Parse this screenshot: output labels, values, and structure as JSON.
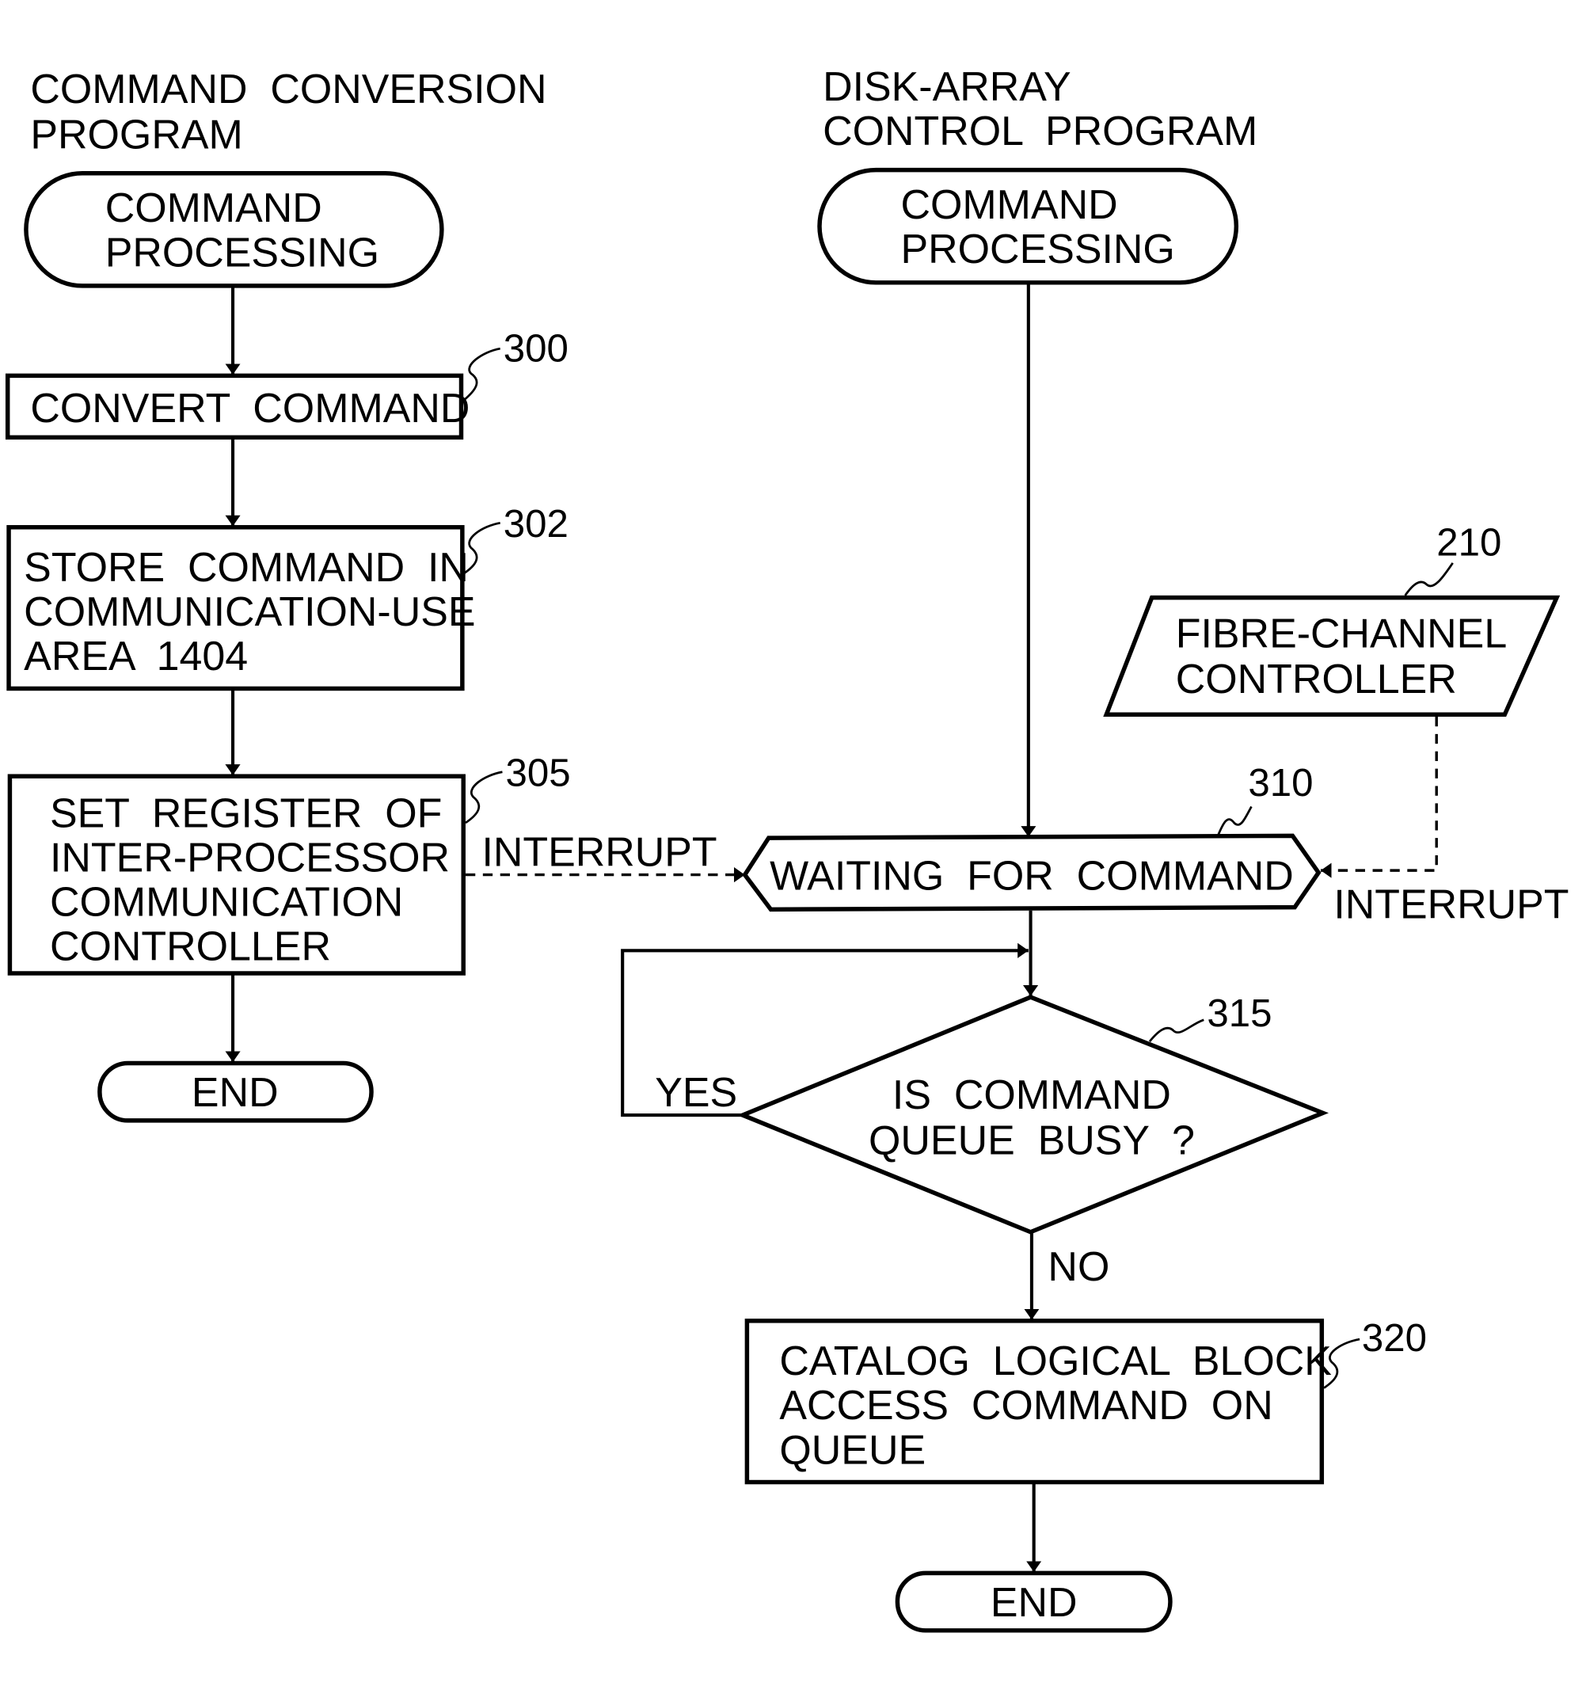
{
  "left_column": {
    "title": [
      "COMMAND  CONVERSION",
      "PROGRAM"
    ],
    "start": [
      "COMMAND",
      "PROCESSING"
    ],
    "steps": [
      {
        "ref": "300",
        "lines": [
          "CONVERT  COMMAND"
        ]
      },
      {
        "ref": "302",
        "lines": [
          "STORE  COMMAND  IN",
          "COMMUNICATION-USE",
          "AREA  1404"
        ]
      },
      {
        "ref": "305",
        "lines": [
          "SET  REGISTER  OF",
          "INTER-PROCESSOR",
          "COMMUNICATION",
          "CONTROLLER"
        ]
      }
    ],
    "end": "END"
  },
  "right_column": {
    "title": [
      "DISK-ARRAY",
      "CONTROL  PROGRAM"
    ],
    "start": [
      "COMMAND",
      "PROCESSING"
    ],
    "external": {
      "ref": "210",
      "lines": [
        "FIBRE-CHANNEL",
        "CONTROLLER"
      ]
    },
    "wait": {
      "ref": "310",
      "label": "WAITING  FOR  COMMAND"
    },
    "decision": {
      "ref": "315",
      "lines": [
        "IS  COMMAND",
        "QUEUE  BUSY  ?"
      ],
      "yes": "YES",
      "no": "NO"
    },
    "catalog": {
      "ref": "320",
      "lines": [
        "CATALOG  LOGICAL  BLOCK",
        "ACCESS  COMMAND  ON",
        "QUEUE"
      ]
    },
    "end": "END"
  },
  "connectors": {
    "interrupt_left": "INTERRUPT",
    "interrupt_right": "INTERRUPT"
  }
}
